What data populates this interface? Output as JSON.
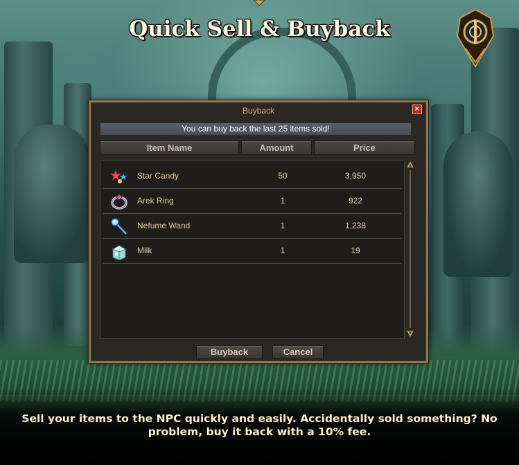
{
  "page": {
    "title": "Quick Sell & Buyback",
    "caption": "Sell your items to the NPC quickly and easily. Accidentally sold something? No problem, buy it back with a 10% fee."
  },
  "dialog": {
    "title": "Buyback",
    "close_label": "×",
    "notice": "You can buy back the last 25 items sold!",
    "columns": {
      "name": "Item Name",
      "amount": "Amount",
      "price": "Price"
    },
    "items": [
      {
        "name": "Star Candy",
        "amount": "50",
        "price": "3,950",
        "icon": "star-candy-icon"
      },
      {
        "name": "Arek Ring",
        "amount": "1",
        "price": "922",
        "icon": "ring-icon"
      },
      {
        "name": "Nefume Wand",
        "amount": "1",
        "price": "1,238",
        "icon": "wand-icon"
      },
      {
        "name": "Milk",
        "amount": "1",
        "price": "19",
        "icon": "milk-icon"
      }
    ],
    "buttons": {
      "buyback": "Buyback",
      "cancel": "Cancel"
    }
  },
  "colors": {
    "dialog_title": "#e8a56a",
    "item_text": "#e6cf98",
    "notice_bg": "#4f5261",
    "close_button": "#b5281e",
    "frame_gold": "#8c7952"
  }
}
